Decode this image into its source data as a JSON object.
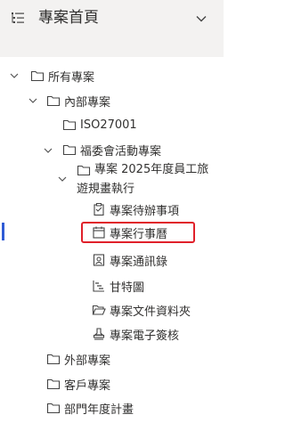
{
  "header": {
    "title": "專案首頁",
    "menu_icon": "tree-list-icon",
    "collapse_icon": "chevron-down-icon"
  },
  "tree": {
    "root": "所有專案",
    "internal": "內部專案",
    "iso": "ISO27001",
    "welfare": "福委會活動專案",
    "travel_line1": "專案 2025年度員工旅",
    "travel_line2": "遊規畫執行",
    "todo": "專案待辦事項",
    "calendar": "專案行事曆",
    "contacts": "專案通訊錄",
    "gantt": "甘特圖",
    "files": "專案文件資料夾",
    "signoff": "專案電子簽核",
    "external": "外部專案",
    "customer": "客戶專案",
    "dept": "部門年度計畫"
  },
  "colors": {
    "header_bg": "#f3f2f1",
    "selection_marker": "#2f5bd5",
    "highlight_border": "#e0202a"
  }
}
